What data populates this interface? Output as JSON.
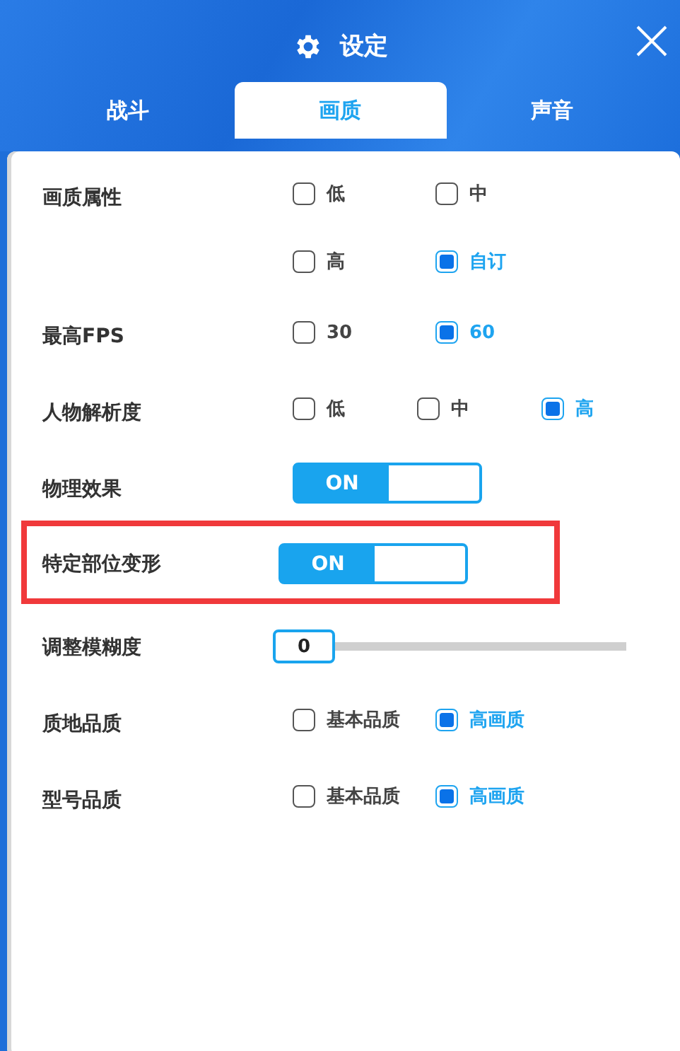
{
  "window": {
    "title": "设定"
  },
  "tabs": [
    {
      "label": "战斗",
      "selected": false
    },
    {
      "label": "画质",
      "selected": true
    },
    {
      "label": "声音",
      "selected": false
    }
  ],
  "rows": [
    {
      "kind": "options",
      "label": "画质属性",
      "highlighted": false,
      "options": [
        {
          "label": "低",
          "selected": false
        },
        {
          "label": "中",
          "selected": false
        },
        {
          "label": "高",
          "selected": false
        },
        {
          "label": "自订",
          "selected": true
        }
      ]
    },
    {
      "kind": "options",
      "label": "最高FPS",
      "highlighted": false,
      "options": [
        {
          "label": "30",
          "selected": false
        },
        {
          "label": "60",
          "selected": true
        }
      ]
    },
    {
      "kind": "options",
      "label": "人物解析度",
      "highlighted": false,
      "options": [
        {
          "label": "低",
          "selected": false
        },
        {
          "label": "中",
          "selected": false
        },
        {
          "label": "高",
          "selected": true
        }
      ]
    },
    {
      "kind": "toggle",
      "label": "物理效果",
      "highlighted": false,
      "on": true,
      "state_label": "ON"
    },
    {
      "kind": "toggle",
      "label": "特定部位变形",
      "highlighted": true,
      "on": true,
      "state_label": "ON"
    },
    {
      "kind": "slider",
      "label": "调整模糊度",
      "highlighted": false,
      "value": "0",
      "level": 0
    },
    {
      "kind": "options",
      "label": "质地品质",
      "highlighted": false,
      "options": [
        {
          "label": "基本品质",
          "selected": false
        },
        {
          "label": "高画质",
          "selected": true
        }
      ]
    },
    {
      "kind": "options",
      "label": "型号品质",
      "highlighted": false,
      "options": [
        {
          "label": "基本品质",
          "selected": false
        },
        {
          "label": "高画质",
          "selected": true
        }
      ]
    }
  ]
}
